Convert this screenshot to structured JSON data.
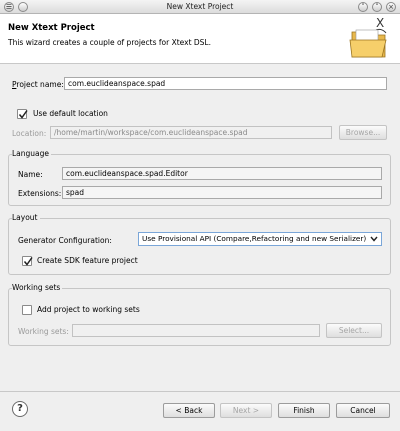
{
  "window": {
    "title": "New Xtext Project"
  },
  "header": {
    "title": "New Xtext Project",
    "description": "This wizard creates a couple of projects for Xtext DSL.",
    "banner_icon": "folder-wizard-icon"
  },
  "project": {
    "name_label": "Project name:",
    "name_value": "com.euclideanspace.spad",
    "use_default_label": "Use default location",
    "use_default_checked": true,
    "location_label": "Location:",
    "location_value": "/home/martin/workspace/com.euclideanspace.spad",
    "browse_label": "Browse..."
  },
  "language": {
    "group_title": "Language",
    "name_label": "Name:",
    "name_value": "com.euclideanspace.spad.Editor",
    "extensions_label": "Extensions:",
    "extensions_value": "spad"
  },
  "layout": {
    "group_title": "Layout",
    "generator_label": "Generator Configuration:",
    "generator_value": "Use Provisional API (Compare,Refactoring and new Serializer)",
    "sdk_label": "Create SDK feature project",
    "sdk_checked": true
  },
  "working_sets": {
    "group_title": "Working sets",
    "add_label": "Add project to working sets",
    "add_checked": false,
    "sets_label": "Working sets:",
    "sets_value": "",
    "select_label": "Select..."
  },
  "footer": {
    "back_label": "< Back",
    "next_label": "Next >",
    "finish_label": "Finish",
    "cancel_label": "Cancel",
    "help_icon": "help-icon",
    "help_glyph": "?"
  }
}
